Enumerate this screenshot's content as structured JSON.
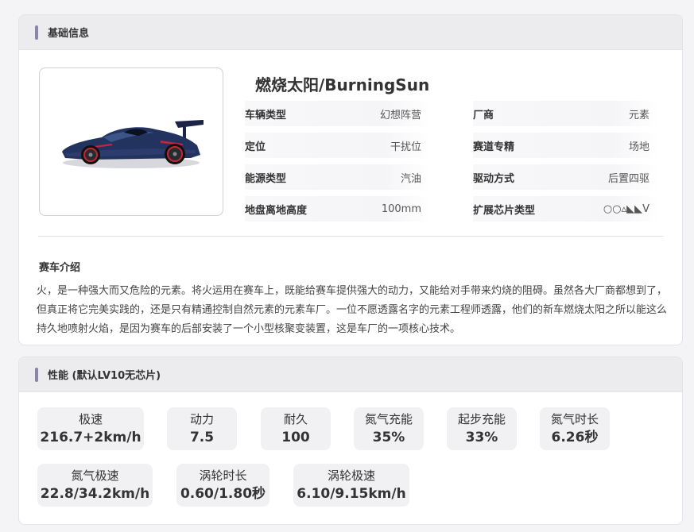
{
  "basic": {
    "header": "基础信息",
    "car_name": "燃烧太阳/BurningSun",
    "attributes": [
      {
        "key": "车辆类型",
        "value": "幻想阵营"
      },
      {
        "key": "厂商",
        "value": "元素"
      },
      {
        "key": "定位",
        "value": "干扰位"
      },
      {
        "key": "赛道专精",
        "value": "场地"
      },
      {
        "key": "能源类型",
        "value": "汽油"
      },
      {
        "key": "驱动方式",
        "value": "后置四驱"
      },
      {
        "key": "地盘离地高度",
        "value": "100mm"
      },
      {
        "key": "扩展芯片类型",
        "value": "○○▵◣◣V"
      }
    ],
    "intro_title": "赛车介绍",
    "intro_text": "火，是一种强大而又危险的元素。将火运用在赛车上，既能给赛车提供强大的动力，又能给对手带来灼烧的阻碍。虽然各大厂商都想到了，但真正将它完美实践的，还是只有精通控制自然元素的元素车厂。一位不愿透露名字的元素工程师透露，他们的新车燃烧太阳之所以能这么持久地喷射火焰，是因为赛车的后部安装了一个小型核聚变装置，这是车厂的一项核心技术。"
  },
  "performance": {
    "header": "性能 (默认LV10无芯片)",
    "stats": [
      {
        "label": "极速",
        "value": "216.7+2km/h"
      },
      {
        "label": "动力",
        "value": "7.5"
      },
      {
        "label": "耐久",
        "value": "100"
      },
      {
        "label": "氮气充能",
        "value": "35%"
      },
      {
        "label": "起步充能",
        "value": "33%"
      },
      {
        "label": "氮气时长",
        "value": "6.26秒"
      },
      {
        "label": "氮气极速",
        "value": "22.8/34.2km/h"
      },
      {
        "label": "涡轮时长",
        "value": "0.60/1.80秒"
      },
      {
        "label": "涡轮极速",
        "value": "6.10/9.15km/h"
      }
    ]
  },
  "colors": {
    "accent_bar": "#8b86a4",
    "card_header_bg": "#ececef",
    "stat_bg": "#f1f1f4",
    "car_body": "#1f2f5c",
    "car_accent": "#c0283a"
  },
  "icons": {
    "header_marker": "vertical-bar",
    "car": "race-car-image"
  }
}
